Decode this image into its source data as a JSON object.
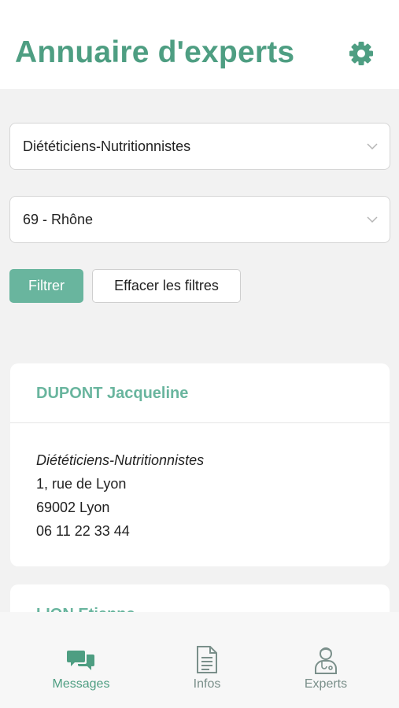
{
  "header": {
    "title": "Annuaire d'experts",
    "settings_icon": "gear-icon"
  },
  "filters": {
    "profession_select": "Diététiciens-Nutritionnistes",
    "department_select": "69 - Rhône",
    "filter_button": "Filtrer",
    "clear_button": "Effacer les filtres"
  },
  "experts": [
    {
      "name": "DUPONT Jacqueline",
      "specialty": "Diététiciens-Nutritionnistes",
      "address": "1, rue de Lyon",
      "city": "69002 Lyon",
      "phone": "06 11 22 33 44"
    },
    {
      "name": "LION Etienne"
    }
  ],
  "tabbar": {
    "messages": "Messages",
    "infos": "Infos",
    "experts": "Experts"
  },
  "colors": {
    "accent": "#4e9e82",
    "accent_light": "#69b59e",
    "inactive": "#7a8f8a"
  }
}
